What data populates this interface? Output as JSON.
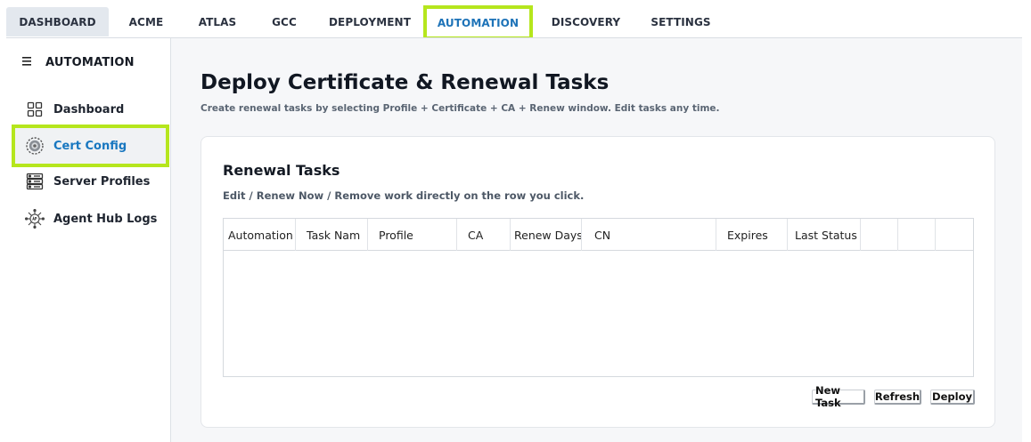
{
  "topnav": {
    "tabs": [
      {
        "label": "DASHBOARD"
      },
      {
        "label": "ACME"
      },
      {
        "label": "ATLAS"
      },
      {
        "label": "GCC"
      },
      {
        "label": "DEPLOYMENT"
      },
      {
        "label": "AUTOMATION"
      },
      {
        "label": "DISCOVERY"
      },
      {
        "label": "SETTINGS"
      }
    ],
    "active": "AUTOMATION"
  },
  "sidebar": {
    "title": "AUTOMATION",
    "items": [
      {
        "label": "Dashboard",
        "icon": "grid-icon"
      },
      {
        "label": "Cert Config",
        "icon": "gear-icon"
      },
      {
        "label": "Server Profiles",
        "icon": "server-icon"
      },
      {
        "label": "Agent Hub Logs",
        "icon": "api-hub-icon"
      }
    ]
  },
  "main": {
    "title": "Deploy Certificate & Renewal Tasks",
    "subtitle": "Create renewal tasks by selecting Profile + Certificate + CA + Renew window. Edit tasks any time."
  },
  "card": {
    "title": "Renewal Tasks",
    "subtitle": "Edit / Renew Now / Remove work directly on the row you click.",
    "columns": [
      "Automation",
      "Task Nam",
      "Profile",
      "CA",
      "Renew Days",
      "CN",
      "Expires",
      "Last Status",
      "",
      "",
      ""
    ],
    "rows": [],
    "buttons": {
      "new_task": "New Task",
      "refresh": "Refresh",
      "deploy": "Deploy"
    }
  },
  "colors": {
    "highlight": "#b5e61d",
    "accent": "#1e73b8"
  }
}
